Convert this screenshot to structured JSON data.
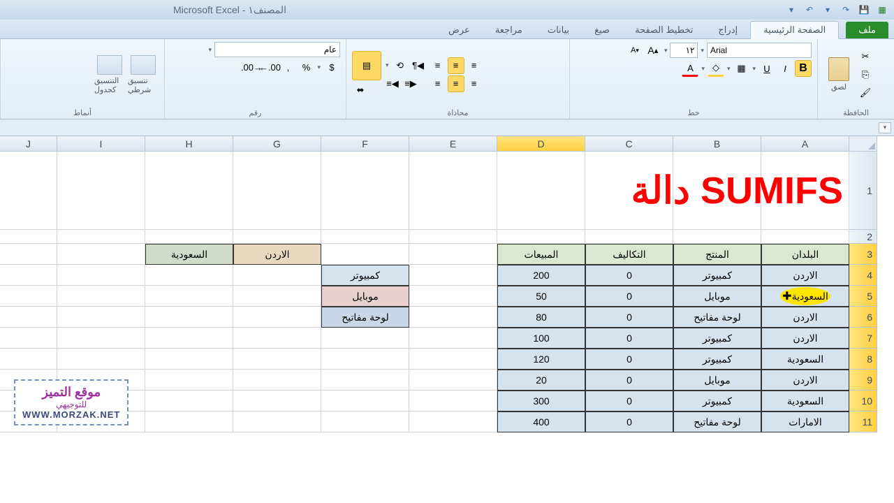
{
  "title": "Microsoft Excel - المصنف١",
  "tabs": {
    "file": "ملف",
    "home": "الصفحة الرئيسية",
    "insert": "إدراج",
    "layout": "تخطيط الصفحة",
    "formulas": "صيغ",
    "data": "بيانات",
    "review": "مراجعة",
    "view": "عرض"
  },
  "ribbon": {
    "clipboard": "الحافظة",
    "paste": "لصق",
    "font": "خط",
    "font_name": "Arial",
    "font_size": "١٢",
    "bold": "B",
    "italic": "I",
    "underline": "U",
    "alignment": "محاذاة",
    "number": "رقم",
    "number_format": "عام",
    "styles": "أنماط",
    "cond_fmt": "تنسيق شرطي",
    "table_fmt": "التنسيق كجدول"
  },
  "columns": [
    "A",
    "B",
    "C",
    "D",
    "E",
    "F",
    "G",
    "H",
    "I",
    "J"
  ],
  "big_title": "دالة SUMIFS",
  "headers": {
    "country": "البلدان",
    "product": "المنتج",
    "cost": "التكاليف",
    "sales": "المبيعات"
  },
  "data_rows": [
    {
      "country": "الاردن",
      "product": "كمبيوتر",
      "cost": "0",
      "sales": "200"
    },
    {
      "country": "السعودية",
      "product": "موبايل",
      "cost": "0",
      "sales": "50"
    },
    {
      "country": "الاردن",
      "product": "لوحة مفاتيح",
      "cost": "0",
      "sales": "80"
    },
    {
      "country": "الاردن",
      "product": "كمبيوتر",
      "cost": "0",
      "sales": "100"
    },
    {
      "country": "السعودية",
      "product": "كمبيوتر",
      "cost": "0",
      "sales": "120"
    },
    {
      "country": "الاردن",
      "product": "موبايل",
      "cost": "0",
      "sales": "20"
    },
    {
      "country": "السعودية",
      "product": "كمبيوتر",
      "cost": "0",
      "sales": "300"
    },
    {
      "country": "الامارات",
      "product": "لوحة مفاتيح",
      "cost": "0",
      "sales": "400"
    }
  ],
  "criteria_products": [
    "كمبيوتر",
    "موبايل",
    "لوحة مفاتيح"
  ],
  "criteria_regions": [
    "الاردن",
    "السعودية"
  ],
  "watermark": {
    "l1": "موقع التميز",
    "l2": "للتوجيهي",
    "l3": "WWW.MORZAK.NET"
  },
  "selected_col": "D",
  "highlighted_row": 5
}
